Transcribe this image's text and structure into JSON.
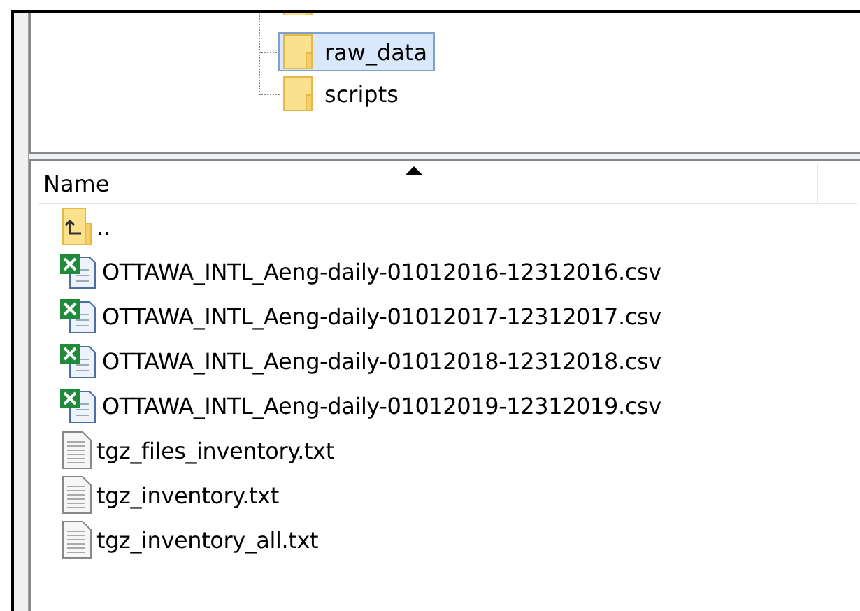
{
  "tree": {
    "items": [
      {
        "label": "raw_data",
        "selected": true
      },
      {
        "label": "scripts",
        "selected": false
      }
    ]
  },
  "file_list": {
    "columns": [
      {
        "label": "Name",
        "sorted": true
      }
    ],
    "rows": [
      {
        "kind": "parent",
        "name": ".."
      },
      {
        "kind": "csv",
        "name": "OTTAWA_INTL_Aeng-daily-01012016-12312016.csv"
      },
      {
        "kind": "csv",
        "name": "OTTAWA_INTL_Aeng-daily-01012017-12312017.csv"
      },
      {
        "kind": "csv",
        "name": "OTTAWA_INTL_Aeng-daily-01012018-12312018.csv"
      },
      {
        "kind": "csv",
        "name": "OTTAWA_INTL_Aeng-daily-01012019-12312019.csv"
      },
      {
        "kind": "text",
        "name": "tgz_files_inventory.txt"
      },
      {
        "kind": "text",
        "name": "tgz_inventory.txt"
      },
      {
        "kind": "text",
        "name": "tgz_inventory_all.txt"
      }
    ]
  }
}
